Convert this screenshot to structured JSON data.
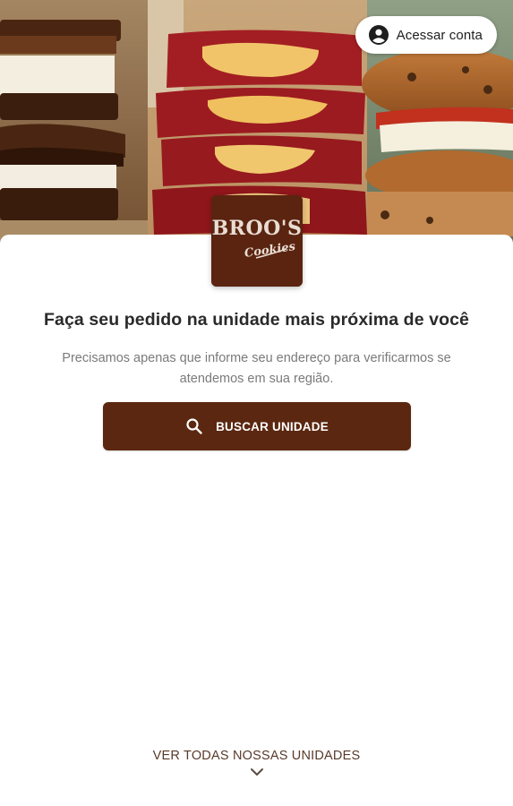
{
  "header": {
    "account_label": "Acessar conta",
    "account_icon": "account-circle-icon"
  },
  "brand": {
    "logo_line1": "BROO'S",
    "logo_line2": "Cookies",
    "logo_bg": "#5a2410"
  },
  "main": {
    "title": "Faça seu pedido na unidade mais próxima de você",
    "subtitle": "Precisamos apenas que informe seu endereço para verificarmos se atendemos em sua região.",
    "search_button": {
      "label": "BUSCAR UNIDADE",
      "icon": "search-icon",
      "color": "#5b2710"
    }
  },
  "footer": {
    "all_units_label": "VER TODAS NOSSAS UNIDADES",
    "chevron_icon": "chevron-down-icon"
  }
}
